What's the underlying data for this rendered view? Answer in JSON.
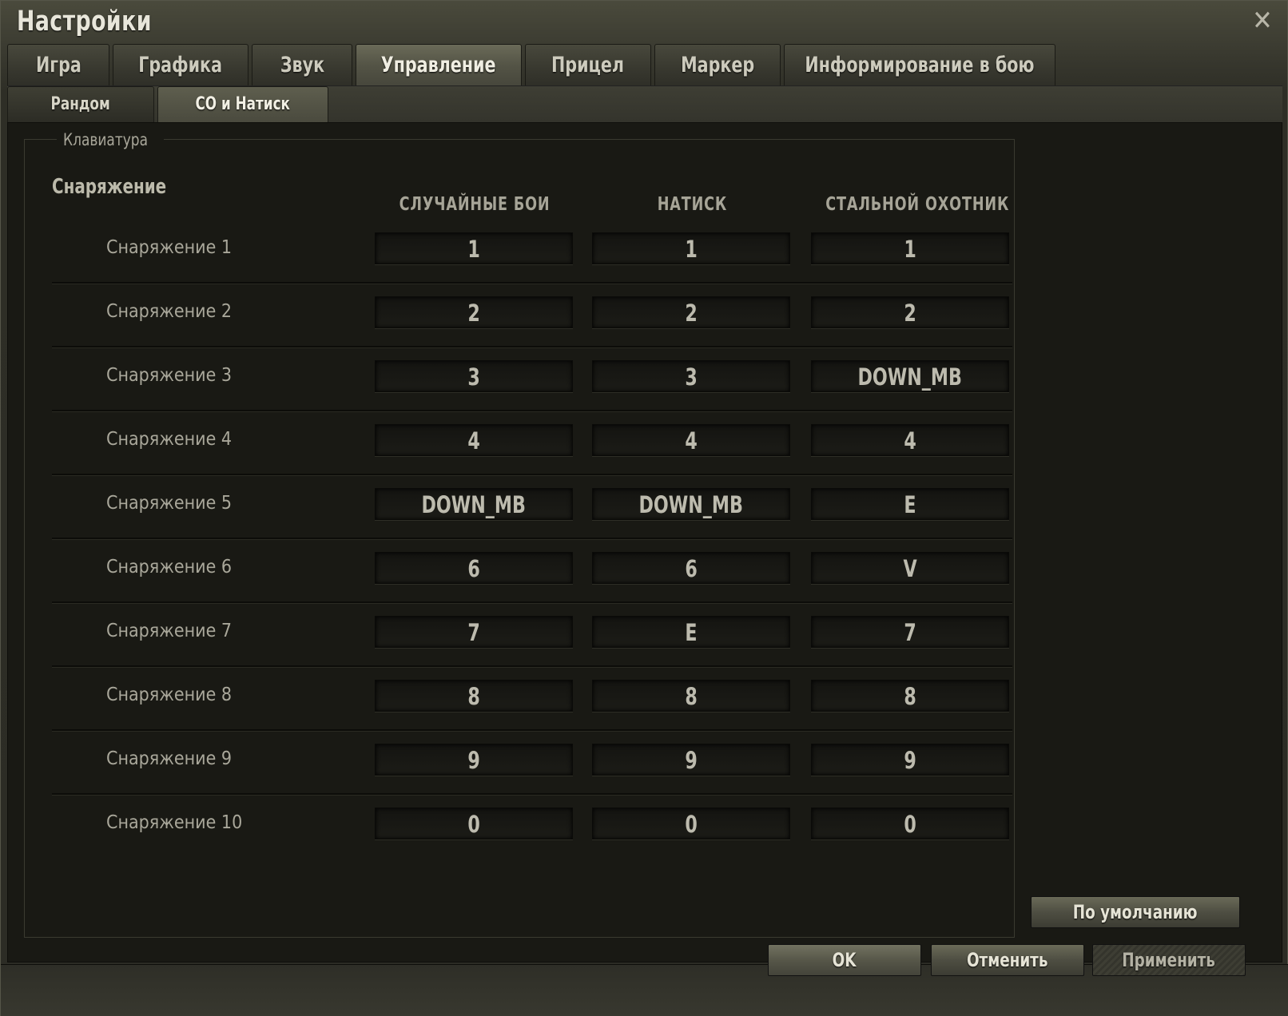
{
  "window": {
    "title": "Настройки"
  },
  "tabs": [
    {
      "label": "Игра"
    },
    {
      "label": "Графика"
    },
    {
      "label": "Звук"
    },
    {
      "label": "Управление"
    },
    {
      "label": "Прицел"
    },
    {
      "label": "Маркер"
    },
    {
      "label": "Информирование в бою"
    }
  ],
  "subtabs": [
    {
      "label": "Рандом"
    },
    {
      "label": "СО и Натиск"
    }
  ],
  "keyboard": {
    "group_label": "Клавиатура",
    "section_title": "Снаряжение",
    "columns": [
      "СЛУЧАЙНЫЕ БОИ",
      "НАТИСК",
      "СТАЛЬНОЙ ОХОТНИК"
    ],
    "rows": [
      {
        "label": "Снаряжение 1",
        "keys": [
          "1",
          "1",
          "1"
        ]
      },
      {
        "label": "Снаряжение 2",
        "keys": [
          "2",
          "2",
          "2"
        ]
      },
      {
        "label": "Снаряжение 3",
        "keys": [
          "3",
          "3",
          "DOWN_MB"
        ]
      },
      {
        "label": "Снаряжение 4",
        "keys": [
          "4",
          "4",
          "4"
        ]
      },
      {
        "label": "Снаряжение 5",
        "keys": [
          "DOWN_MB",
          "DOWN_MB",
          "E"
        ]
      },
      {
        "label": "Снаряжение 6",
        "keys": [
          "6",
          "6",
          "V"
        ]
      },
      {
        "label": "Снаряжение 7",
        "keys": [
          "7",
          "E",
          "7"
        ]
      },
      {
        "label": "Снаряжение 8",
        "keys": [
          "8",
          "8",
          "8"
        ]
      },
      {
        "label": "Снаряжение 9",
        "keys": [
          "9",
          "9",
          "9"
        ]
      },
      {
        "label": "Снаряжение 10",
        "keys": [
          "0",
          "0",
          "0"
        ]
      }
    ]
  },
  "buttons": {
    "defaults": "По умолчанию",
    "ok": "OK",
    "cancel": "Отменить",
    "apply": "Применить"
  }
}
